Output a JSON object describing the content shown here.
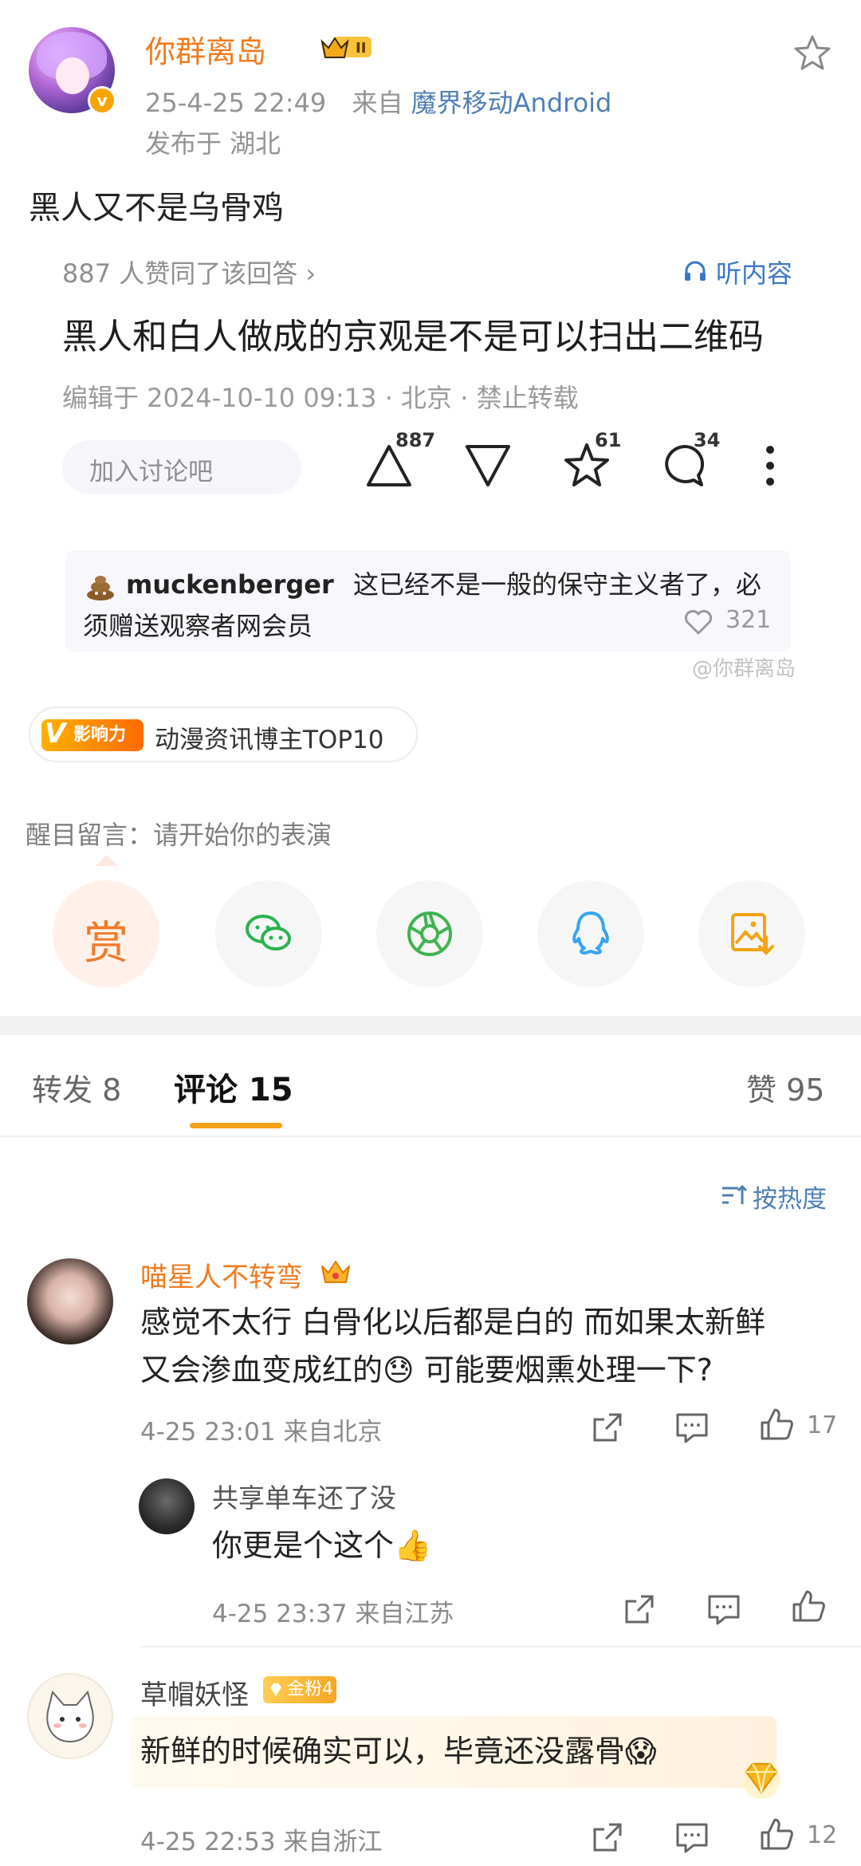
{
  "post": {
    "author": "你群离岛",
    "level_badge": "II",
    "time": "25-4-25 22:49",
    "from_prefix": "来自",
    "source": "魔界移动Android",
    "location": "发布于 湖北",
    "text": "黑人又不是乌骨鸡"
  },
  "quote": {
    "agree_text": "887 人赞同了该回答 ›",
    "listen_label": "听内容",
    "title": "黑人和白人做成的京观是不是可以扫出二维码",
    "edit_line": "编辑于 2024-10-10 09:13 · 北京 · 禁止转载",
    "discuss_placeholder": "加入讨论吧",
    "upvote_count": "887",
    "star_count": "61",
    "comment_count": "34",
    "hot_comment": {
      "user": "muckenberger",
      "text_line1": "这已经不是一般的保守主义者了，必",
      "text_line2": "须赠送观察者网会员",
      "likes": "321"
    }
  },
  "watermark": "@你群离岛",
  "influence": {
    "badge_v": "V",
    "badge_text": "影响力",
    "label": "动漫资讯博主TOP10"
  },
  "message_hint": "醒目留言：请开始你的表演",
  "share": {
    "reward_label": "赏"
  },
  "tabs": {
    "repost": "转发 8",
    "comment": "评论 15",
    "like": "赞 95"
  },
  "sort_label": "按热度",
  "comments": [
    {
      "name": "喵星人不转弯",
      "line1": "感觉不太行 白骨化以后都是白的 而如果太新鲜",
      "line2": "又会渗血变成红的😓 可能要烟熏处理一下?",
      "meta": "4-25 23:01  来自北京",
      "likes": "17"
    },
    {
      "name": "共享单车还了没",
      "text": "你更是个这个👍",
      "meta": "4-25 23:37  来自江苏"
    },
    {
      "name": "草帽妖怪",
      "fan_badge": "金粉4",
      "text": "新鲜的时候确实可以，毕竟还没露骨😱",
      "meta": "4-25 22:53  来自浙江",
      "likes": "12"
    }
  ],
  "colors": {
    "username": "#f07b1e",
    "link": "#4f7eb7",
    "tab_accent": "#f7a21b"
  }
}
